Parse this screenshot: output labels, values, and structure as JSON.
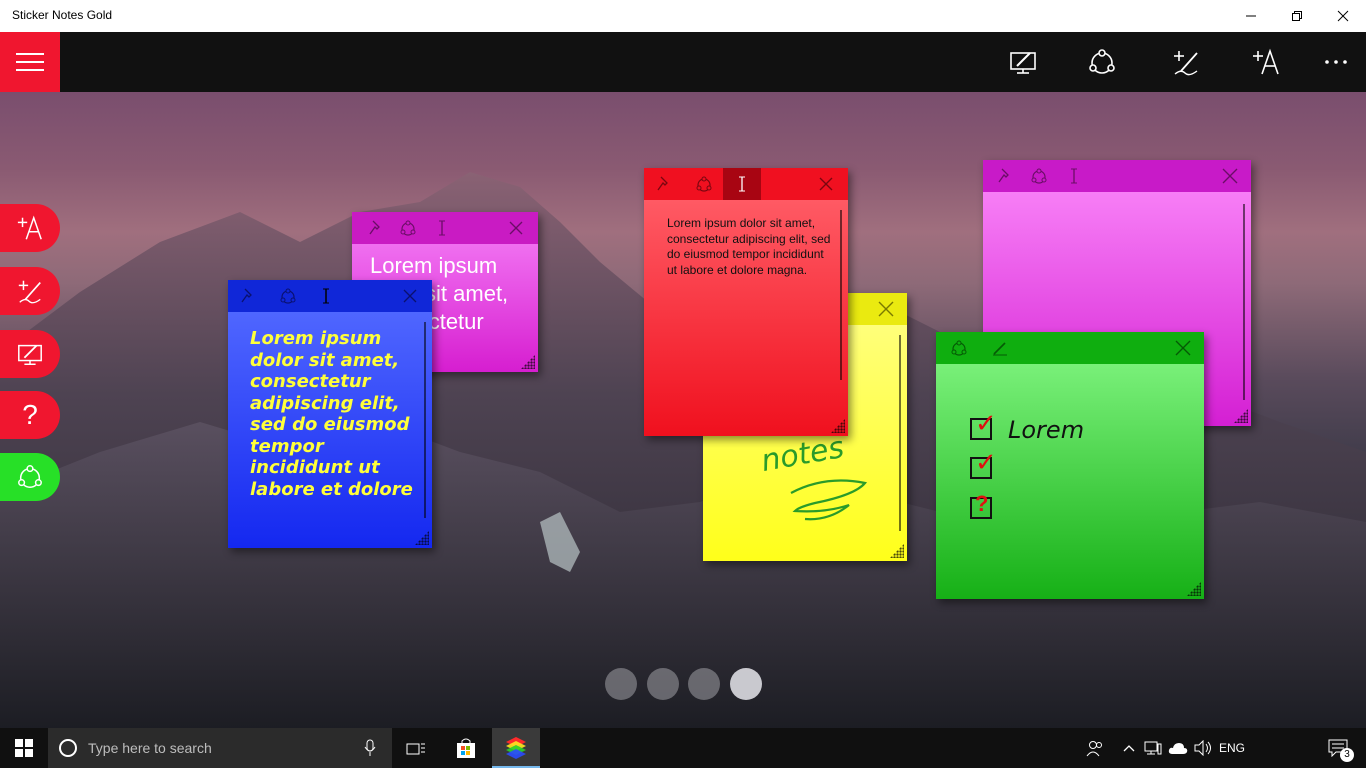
{
  "window": {
    "title": "Sticker Notes Gold"
  },
  "toolbar": {
    "menu_icon": "hamburger-icon",
    "buttons": [
      "desktop-edit-icon",
      "share-icon",
      "add-handwriting-icon",
      "add-text-icon",
      "more-icon"
    ]
  },
  "sidebar": {
    "buttons": [
      {
        "icon": "add-text-icon",
        "color": "#f0162f"
      },
      {
        "icon": "add-handwriting-icon",
        "color": "#f0162f"
      },
      {
        "icon": "desktop-edit-icon",
        "color": "#f0162f"
      },
      {
        "icon": "help-icon",
        "color": "#f0162f",
        "glyph": "?"
      },
      {
        "icon": "share-icon",
        "color": "#27e027"
      }
    ]
  },
  "notes": {
    "magenta_small": {
      "text": "Lorem ipsum dolor sit amet, consectetur",
      "color": "#e03cd8"
    },
    "blue": {
      "text": "Lorem ipsum dolor sit amet, consectetur adipiscing elit, sed do eiusmod tempor incididunt ut labore et dolore",
      "color": "#1f35f5"
    },
    "red": {
      "text": "Lorem ipsum dolor sit amet, consectetur adipiscing elit, sed do eiusmod tempor incididunt ut labore et dolore magna.",
      "color": "#f01a28"
    },
    "yellow": {
      "handwriting": "notes",
      "color": "#ffff3a"
    },
    "magenta_large": {
      "text": "",
      "color": "#e84ce6"
    },
    "green": {
      "checklist": [
        "Lorem",
        "",
        ""
      ],
      "marks": [
        "✓",
        "✓",
        "?"
      ],
      "color": "#2fc52f"
    }
  },
  "pager": {
    "count": 4,
    "active": 3
  },
  "taskbar": {
    "search_placeholder": "Type here to search",
    "language": "ENG",
    "notification_count": "3"
  }
}
